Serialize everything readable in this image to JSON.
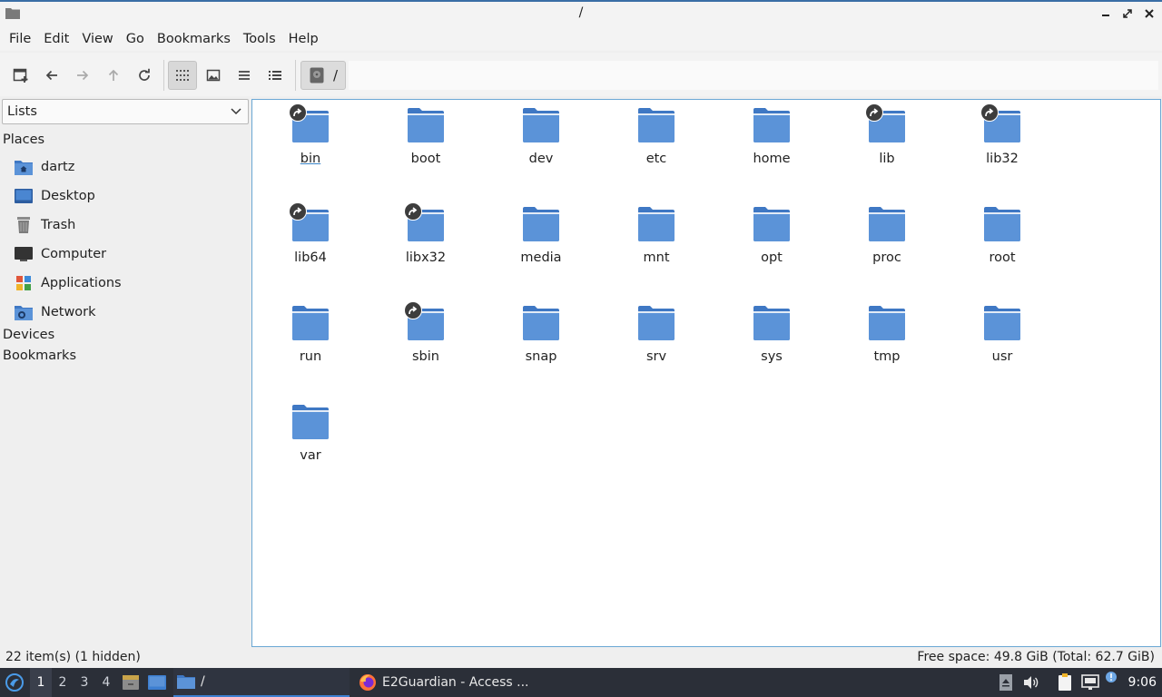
{
  "window": {
    "title": "/"
  },
  "menu": [
    "File",
    "Edit",
    "View",
    "Go",
    "Bookmarks",
    "Tools",
    "Help"
  ],
  "toolbar": {
    "buttons": [
      "new-window-icon",
      "back-icon",
      "forward-icon",
      "up-icon",
      "reload-icon",
      "icon-view-icon",
      "thumbnail-view-icon",
      "compact-view-icon",
      "detailed-list-icon"
    ],
    "path": "/"
  },
  "sidebar": {
    "selector": "Lists",
    "places_heading": "Places",
    "places": [
      {
        "label": "dartz",
        "icon": "home-folder-icon"
      },
      {
        "label": "Desktop",
        "icon": "desktop-icon"
      },
      {
        "label": "Trash",
        "icon": "trash-icon"
      },
      {
        "label": "Computer",
        "icon": "computer-icon"
      },
      {
        "label": "Applications",
        "icon": "applications-icon"
      },
      {
        "label": "Network",
        "icon": "network-icon"
      }
    ],
    "devices_heading": "Devices",
    "bookmarks_heading": "Bookmarks"
  },
  "files": [
    {
      "name": "bin",
      "link": true
    },
    {
      "name": "boot",
      "link": false
    },
    {
      "name": "dev",
      "link": false
    },
    {
      "name": "etc",
      "link": false
    },
    {
      "name": "home",
      "link": false
    },
    {
      "name": "lib",
      "link": true
    },
    {
      "name": "lib32",
      "link": true
    },
    {
      "name": "lib64",
      "link": true
    },
    {
      "name": "libx32",
      "link": true
    },
    {
      "name": "media",
      "link": false
    },
    {
      "name": "mnt",
      "link": false
    },
    {
      "name": "opt",
      "link": false
    },
    {
      "name": "proc",
      "link": false
    },
    {
      "name": "root",
      "link": false
    },
    {
      "name": "run",
      "link": false
    },
    {
      "name": "sbin",
      "link": true
    },
    {
      "name": "snap",
      "link": false
    },
    {
      "name": "srv",
      "link": false
    },
    {
      "name": "sys",
      "link": false
    },
    {
      "name": "tmp",
      "link": false
    },
    {
      "name": "usr",
      "link": false
    },
    {
      "name": "var",
      "link": false
    }
  ],
  "status": {
    "items": "22 item(s) (1 hidden)",
    "free_space": "Free space: 49.8 GiB (Total: 62.7 GiB)"
  },
  "taskbar": {
    "workspaces": [
      "1",
      "2",
      "3",
      "4"
    ],
    "active_workspace": "1",
    "tasks": [
      {
        "label": "/",
        "icon": "folder-icon"
      },
      {
        "label": "E2Guardian - Access ...",
        "icon": "firefox-icon"
      }
    ],
    "clock": "9:06"
  },
  "colors": {
    "folder": "#5b93d8",
    "folder_tab": "#3f78c4",
    "accent": "#3d7fd1",
    "taskbar": "#2b2f38"
  }
}
